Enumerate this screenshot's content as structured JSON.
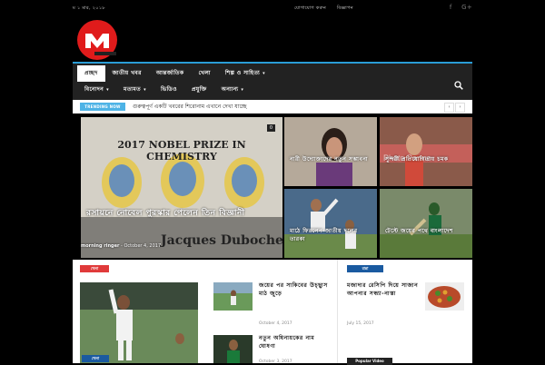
{
  "topbar": {
    "date": "ম ১ মার, ২০১৮",
    "links": [
      "যোগাযোগ করুন",
      "বিজ্ঞাপন"
    ],
    "social": [
      "f",
      "G+"
    ]
  },
  "nav": {
    "row1": [
      {
        "label": "প্রচ্ছদ",
        "active": true,
        "caret": false
      },
      {
        "label": "জাতীয় খবর",
        "active": false,
        "caret": false
      },
      {
        "label": "আন্তর্জাতিক",
        "active": false,
        "caret": false
      },
      {
        "label": "খেলা",
        "active": false,
        "caret": false
      },
      {
        "label": "শিল্প ও সাহিত্য",
        "active": false,
        "caret": true
      }
    ],
    "row2": [
      {
        "label": "বিনোদন",
        "active": false,
        "caret": true
      },
      {
        "label": "মতামত",
        "active": false,
        "caret": true
      },
      {
        "label": "ভিডিও",
        "active": false,
        "caret": false
      },
      {
        "label": "প্রযুক্তি",
        "active": false,
        "caret": false
      },
      {
        "label": "অন্যান্য",
        "active": false,
        "caret": true
      }
    ]
  },
  "trending": {
    "badge": "TRENDING NOW",
    "headline": "গুরুত্বপূর্ণ একটি খবরের শিরোনাম এখানে দেখা যাচ্ছে",
    "prev": "‹",
    "next": "›"
  },
  "featured": {
    "big": {
      "title": "রসায়নে নোবেল পুরস্কার পেলেন তিন বিজ্ঞানী",
      "author": "morning ringer",
      "date": "October 4, 2017",
      "count": "0",
      "poster_heading": "2017 NOBEL PRIZE IN CHEMISTRY",
      "poster_name": "Jacques Dubochet"
    },
    "small": [
      {
        "title": "নারী উদ্যোক্তাদের নতুন সম্ভাবনা"
      },
      {
        "title": "সুন্দরী প্রতিযোগিতায় চমক"
      },
      {
        "title": "মাঠে ফিরলেন জাতীয় দলের তারকা"
      },
      {
        "title": "টেস্টে জয়ের পথে বাংলাদেশ"
      }
    ]
  },
  "posts": {
    "left_tag": "খেলা",
    "left_thumb_tag": "খেলা",
    "items": [
      {
        "title": "জয়ের পর সাকিবের উচ্ছ্বাস মাঠ জুড়ে",
        "date": "October 4, 2017"
      },
      {
        "title": "নতুন অধিনায়কের নাম ঘোষণা",
        "date": "October 3, 2017"
      }
    ]
  },
  "sidebar": {
    "tag": "রান্না",
    "item": {
      "title": "মজাদার রেসিপি দিয়ে সাজান আপনার সন্ধ্যা-নাস্তা",
      "date": "July 15, 2017"
    },
    "popular_label": "Popular Video"
  },
  "colors": {
    "accent": "#2a9dd6",
    "brand": "#e01b1b",
    "trending": "#4eb3e6",
    "tag_red": "#e03a3a",
    "tag_blue": "#1a5aa0"
  }
}
